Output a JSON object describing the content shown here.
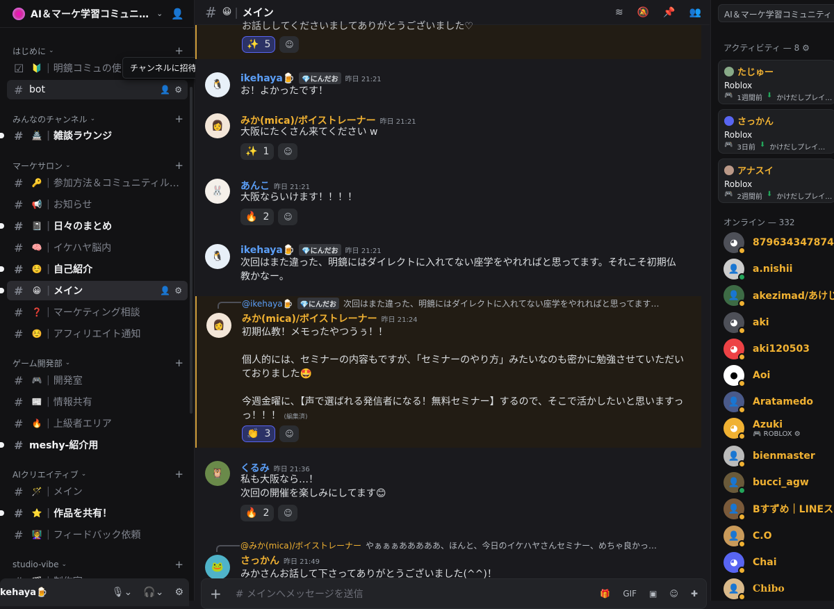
{
  "server": {
    "name": "AI＆マーケ学習コミュニ…",
    "tooltip": "チャンネルに招待"
  },
  "sidebar": {
    "categories": [
      {
        "label": "はじめに"
      },
      {
        "label": "みんなのチャンネル"
      },
      {
        "label": "マーケサロン"
      },
      {
        "label": "ゲーム開発部"
      },
      {
        "label": "AIクリエイティブ"
      },
      {
        "label": "studio-vibe"
      }
    ],
    "channels": [
      {
        "emoji": "🔰",
        "label": "明鏡コミュの使"
      },
      {
        "emoji": "",
        "label": "bot"
      },
      {
        "emoji": "🏯",
        "label": "雑談ラウンジ"
      },
      {
        "emoji": "🔑",
        "label": "参加方法＆コミュニティル…"
      },
      {
        "emoji": "📢",
        "label": "お知らせ"
      },
      {
        "emoji": "📓",
        "label": "日々のまとめ"
      },
      {
        "emoji": "🧠",
        "label": "イケハヤ脳内"
      },
      {
        "emoji": "☺️",
        "label": "自己紹介"
      },
      {
        "emoji": "😀",
        "label": "メイン"
      },
      {
        "emoji": "❓",
        "label": "マーケティング相談"
      },
      {
        "emoji": "☺️",
        "label": "アフィリエイト通知"
      },
      {
        "emoji": "🎮",
        "label": "開発室"
      },
      {
        "emoji": "📰",
        "label": "情報共有"
      },
      {
        "emoji": "🔥",
        "label": "上級者エリア"
      },
      {
        "emoji": "",
        "label": "meshy-紹介用"
      },
      {
        "emoji": "🪄",
        "label": "メイン"
      },
      {
        "emoji": "⭐",
        "label": "作品を共有！"
      },
      {
        "emoji": "👩‍🏫",
        "label": "フィードバック依頼"
      },
      {
        "emoji": "🎬",
        "label": "制作室"
      }
    ],
    "user": {
      "name": "kehaya🍺"
    }
  },
  "channel": {
    "emoji": "😀",
    "name": "メイン",
    "composer_placeholder": "メインへメッセージを送信"
  },
  "messages": [
    {
      "text": "お話ししてくださいましてありがとうございました♡",
      "reactions": [
        {
          "emoji": "✨",
          "count": "5"
        }
      ]
    },
    {
      "author": "ikehaya🍺",
      "tag": "💎にんだお",
      "time": "昨日 21:21",
      "text": "お！よかったです！"
    },
    {
      "author": "みか(mica)/ボイストレーナー",
      "time": "昨日 21:21",
      "text": "大阪にたくさん来てください w",
      "reactions": [
        {
          "emoji": "✨",
          "count": "1"
        }
      ]
    },
    {
      "author": "あんこ",
      "time": "昨日 21:21",
      "text": "大阪ならいけます！！！！",
      "reactions": [
        {
          "emoji": "🔥",
          "count": "2"
        }
      ]
    },
    {
      "author": "ikehaya🍺",
      "tag": "💎にんだお",
      "time": "昨日 21:21",
      "text": "次回はまた違った、明鏡にはダイレクトに入れてない座学をやれればと思ってます。それこそ初期仏教かなー。"
    },
    {
      "reply_author": "@ikehaya🍺",
      "reply_tag": "💎にんだお",
      "reply_text": "次回はまた違った、明鏡にはダイレクトに入れてない座学をやれればと思ってます…",
      "author": "みか(mica)/ボイストレーナー",
      "time": "昨日 21:24",
      "text": "初期仏教！メモったやつうぅ！！\n\n個人的には、セミナーの内容もですが、「セミナーのやり方」みたいなのも密かに勉強させていただいておりました🤩\n\n今週金曜に、【声で選ばれる発信者になる！無料セミナー】するので、そこで活かしたいと思いますっっ！！！",
      "edited": "(編集済)",
      "reactions": [
        {
          "emoji": "👏",
          "count": "3"
        }
      ]
    },
    {
      "author": "くるみ",
      "time": "昨日 21:36",
      "text": "私も大阪なら…！\n次回の開催を楽しみにしてます😊",
      "reactions": [
        {
          "emoji": "🔥",
          "count": "2"
        }
      ]
    },
    {
      "reply_author": "@みか(mica)/ボイストレーナー",
      "reply_text": "やぁぁぁあああああ、ほんと、今日のイケハヤさんセミナー、めちゃ良かっ…",
      "author": "さっかん",
      "time": "昨日 21:49",
      "text": "みかさんお話して下さってありがとうございました(^^)！"
    }
  ],
  "right": {
    "search_placeholder": "AI＆マーケ学習コミュニティ",
    "activity_header": "アクティビティ — 8",
    "activities": [
      {
        "name": "たじゅー",
        "game": "Roblox",
        "ago": "1週間前",
        "label": "かけだしプレイ…"
      },
      {
        "name": "さっかん",
        "game": "Roblox",
        "ago": "3日前",
        "label": "かけだしプレイ…"
      },
      {
        "name": "アナスイ",
        "game": "Roblox",
        "ago": "2週間前",
        "label": "かけだしプレイ…"
      }
    ],
    "online_header": "オンライン — 332",
    "members": [
      {
        "name": "879634347874",
        "sub": ""
      },
      {
        "name": "a.nishii",
        "sub": ""
      },
      {
        "name": "akezimad/あけじま",
        "sub": ""
      },
      {
        "name": "aki",
        "sub": ""
      },
      {
        "name": "aki120503",
        "sub": ""
      },
      {
        "name": "Aoi",
        "sub": ""
      },
      {
        "name": "Aratamedo",
        "sub": ""
      },
      {
        "name": "Azuki",
        "sub": "ROBLOX"
      },
      {
        "name": "bienmaster",
        "sub": ""
      },
      {
        "name": "bucci_agw",
        "sub": ""
      },
      {
        "name": "Bすずめ｜LINEスタ",
        "sub": ""
      },
      {
        "name": "C.O",
        "sub": ""
      },
      {
        "name": "Chai",
        "sub": ""
      },
      {
        "name": "Chibo",
        "sub": ""
      }
    ]
  },
  "colors": {
    "accent": "#5865f2",
    "highlight": "#d09f3c",
    "name_gold": "#f0b132",
    "name_blue": "#5b9ef6",
    "online": "#23a55a",
    "idle": "#f0b132"
  }
}
